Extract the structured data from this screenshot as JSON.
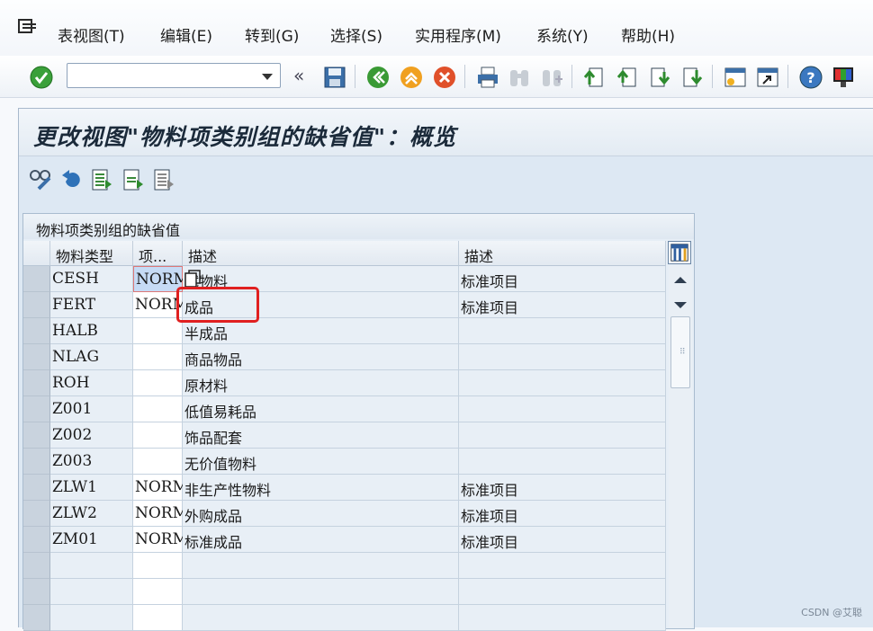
{
  "menubar": {
    "icon": "menu-icon",
    "items": [
      {
        "label": "表视图(T)"
      },
      {
        "label": "编辑(E)"
      },
      {
        "label": "转到(G)"
      },
      {
        "label": "选择(S)"
      },
      {
        "label": "实用程序(M)"
      },
      {
        "label": "系统(Y)"
      },
      {
        "label": "帮助(H)"
      }
    ]
  },
  "toolbar": {
    "command_field_value": "",
    "icons": [
      "enter-icon",
      "dropdown-icon",
      "back-double-icon",
      "save-icon",
      "back-icon",
      "exit-icon",
      "cancel-icon",
      "print-icon",
      "find-icon",
      "find-next-icon",
      "first-page-icon",
      "previous-page-icon",
      "next-page-icon",
      "last-page-icon",
      "create-session-icon",
      "shortcut-icon",
      "help-icon",
      "customize-layout-icon"
    ]
  },
  "screen": {
    "title": "更改视图\"物料项类别组的缺省值\"：概览",
    "app_tools": [
      "display-change-icon",
      "undo-icon",
      "select-all-icon",
      "select-block-icon",
      "deselect-all-icon"
    ]
  },
  "table": {
    "title": "物料项类别组的缺省值",
    "columns": [
      "物料类型",
      "项...",
      "描述",
      "描述"
    ],
    "rows": [
      {
        "type": "CESH",
        "item": "NORM",
        "desc": "试物料",
        "desc2": "标准项目"
      },
      {
        "type": "FERT",
        "item": "NORM",
        "desc": "成品",
        "desc2": "标准项目"
      },
      {
        "type": "HALB",
        "item": "",
        "desc": "半成品",
        "desc2": ""
      },
      {
        "type": "NLAG",
        "item": "",
        "desc": "商品物品",
        "desc2": ""
      },
      {
        "type": "ROH",
        "item": "",
        "desc": "原材料",
        "desc2": ""
      },
      {
        "type": "Z001",
        "item": "",
        "desc": "低值易耗品",
        "desc2": ""
      },
      {
        "type": "Z002",
        "item": "",
        "desc": "饰品配套",
        "desc2": ""
      },
      {
        "type": "Z003",
        "item": "",
        "desc": "无价值物料",
        "desc2": ""
      },
      {
        "type": "ZLW1",
        "item": "NORM",
        "desc": "非生产性物料",
        "desc2": "标准项目"
      },
      {
        "type": "ZLW2",
        "item": "NORM",
        "desc": "外购成品",
        "desc2": "标准项目"
      },
      {
        "type": "ZM01",
        "item": "NORM",
        "desc": "标准成品",
        "desc2": "标准项目"
      },
      {
        "type": "",
        "item": "",
        "desc": "",
        "desc2": ""
      },
      {
        "type": "",
        "item": "",
        "desc": "",
        "desc2": ""
      },
      {
        "type": "",
        "item": "",
        "desc": "",
        "desc2": ""
      }
    ]
  },
  "watermark": "CSDN @艾聪",
  "colors": {
    "annotation": "#e02020",
    "accent": "#1b5a9c"
  }
}
